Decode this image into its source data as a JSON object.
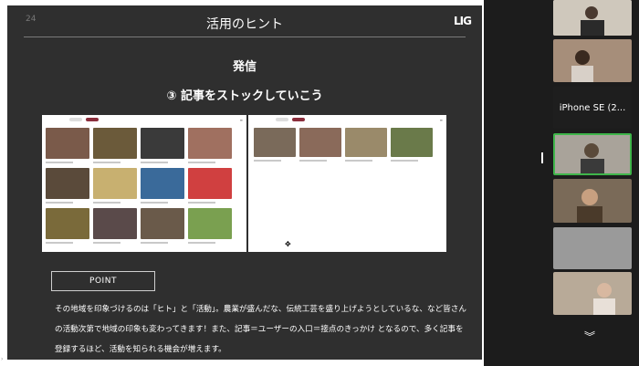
{
  "slide": {
    "page_number": "24",
    "title": "活用のヒント",
    "logo": "LIG",
    "subtitle": "発信",
    "heading": "③ 記事をストックしていこう",
    "point_label": "POINT",
    "body": "その地域を印象づけるのは「ヒト」と「活動」。農業が盛んだな、伝統工芸を盛り上げようとしているな、など皆さんの活動次第で地域の印象も変わってきます！また、記事＝ユーザーの入口＝接点のきっかけ となるので、多く記事を登録するほど、活動を知られる機会が増えます。"
  },
  "participants": [
    {
      "label": ""
    },
    {
      "label": ""
    },
    {
      "label": "iPhone SE (2..."
    },
    {
      "label": ""
    },
    {
      "label": ""
    },
    {
      "label": ""
    },
    {
      "label": ""
    }
  ],
  "colors": {
    "slide_bg": "#2f2f2f",
    "active_speaker_border": "#3fb54a",
    "pill_accent": "#8b2e3c"
  },
  "icons": {
    "scroll_down": "chevron-down-icon",
    "scroll_left": "chevron-left-icon"
  }
}
